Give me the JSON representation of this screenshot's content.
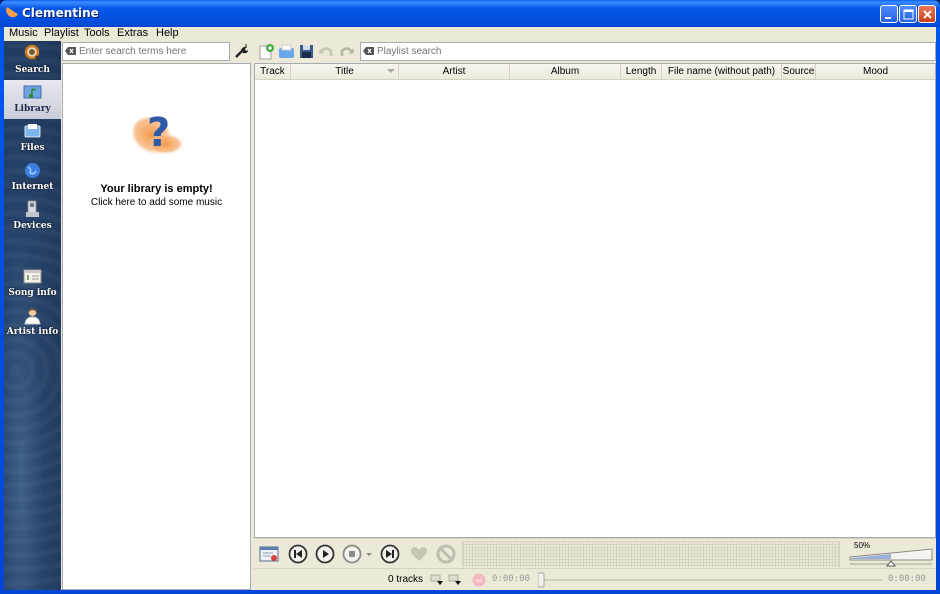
{
  "window": {
    "title": "Clementine",
    "controls": [
      "minimize",
      "maximize",
      "close"
    ]
  },
  "menubar": {
    "items": [
      {
        "label": "Music"
      },
      {
        "label": "Playlist"
      },
      {
        "label": "Tools"
      },
      {
        "label": "Extras"
      },
      {
        "label": "Help"
      }
    ]
  },
  "sidebar": {
    "tabs": [
      {
        "label": "Search",
        "icon": "search-icon",
        "active": false
      },
      {
        "label": "Library",
        "icon": "library-icon",
        "active": true
      },
      {
        "label": "Files",
        "icon": "files-icon",
        "active": false
      },
      {
        "label": "Internet",
        "icon": "internet-icon",
        "active": false
      },
      {
        "label": "Devices",
        "icon": "devices-icon",
        "active": false
      },
      {
        "label": "Song info",
        "icon": "song-info-icon",
        "active": false
      },
      {
        "label": "Artist info",
        "icon": "artist-info-icon",
        "active": false
      }
    ]
  },
  "library": {
    "search_placeholder": "Enter search terms here",
    "search_value": "",
    "empty_title": "Your library is empty!",
    "empty_subtitle": "Click here to add some music"
  },
  "playlist": {
    "toolbar": [
      "new-playlist-icon",
      "load-playlist-icon",
      "save-playlist-icon",
      "undo-icon",
      "redo-icon"
    ],
    "search_placeholder": "Playlist search",
    "search_value": "",
    "columns": [
      {
        "label": "Track"
      },
      {
        "label": "Title",
        "sorted": true
      },
      {
        "label": "Artist"
      },
      {
        "label": "Album"
      },
      {
        "label": "Length"
      },
      {
        "label": "File name (without path)"
      },
      {
        "label": "Source"
      },
      {
        "label": "Mood"
      }
    ],
    "rows": []
  },
  "player": {
    "buttons": [
      "playlist-toggle",
      "previous",
      "play",
      "stop",
      "stop-after",
      "next",
      "love",
      "ban"
    ],
    "volume_percent": 50,
    "volume_label": "50%"
  },
  "status": {
    "tracks": "0 tracks",
    "elapsed": "0:00:00",
    "total": "0:00:00",
    "seek_fraction": 0
  }
}
